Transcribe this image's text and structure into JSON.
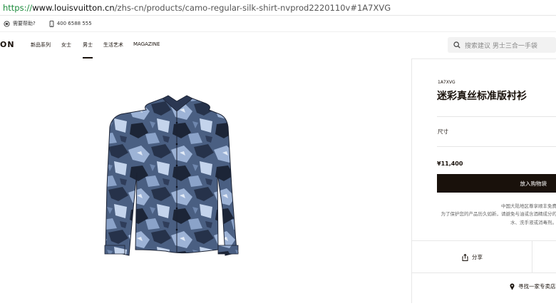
{
  "browser": {
    "url_scheme": "https://",
    "url_host": "www.louisvuitton.cn",
    "url_path": "/zhs-cn/products/camo-regular-silk-shirt-nvprod2220110v#1A7XVG"
  },
  "topbar": {
    "help_label": "需要帮助?",
    "phone": "400 6588 555"
  },
  "header": {
    "logo_text": "ON",
    "nav": [
      "新品系列",
      "女士",
      "男士",
      "生活艺术",
      "MAGAZINE"
    ],
    "active_nav": "男士",
    "search_placeholder": "搜索建议 男士三合一手袋"
  },
  "product": {
    "sku": "1A7XVG",
    "title": "迷彩真丝标准版衬衫",
    "size_label": "尺寸",
    "price": "¥11,400",
    "add_to_bag": "放入购物袋",
    "note_line1": "中国大陆地区尊享顺丰免费",
    "note_line2": "为了保护您的产品历久如新，请避免与油或含酒精成分的",
    "note_line3": "水、洗手液或消毒剂。",
    "share_label": "分享",
    "store_label": "寻找一家专卖店"
  },
  "colors": {
    "brand_dark": "#19110b",
    "url_secure": "#1a8a3a"
  }
}
